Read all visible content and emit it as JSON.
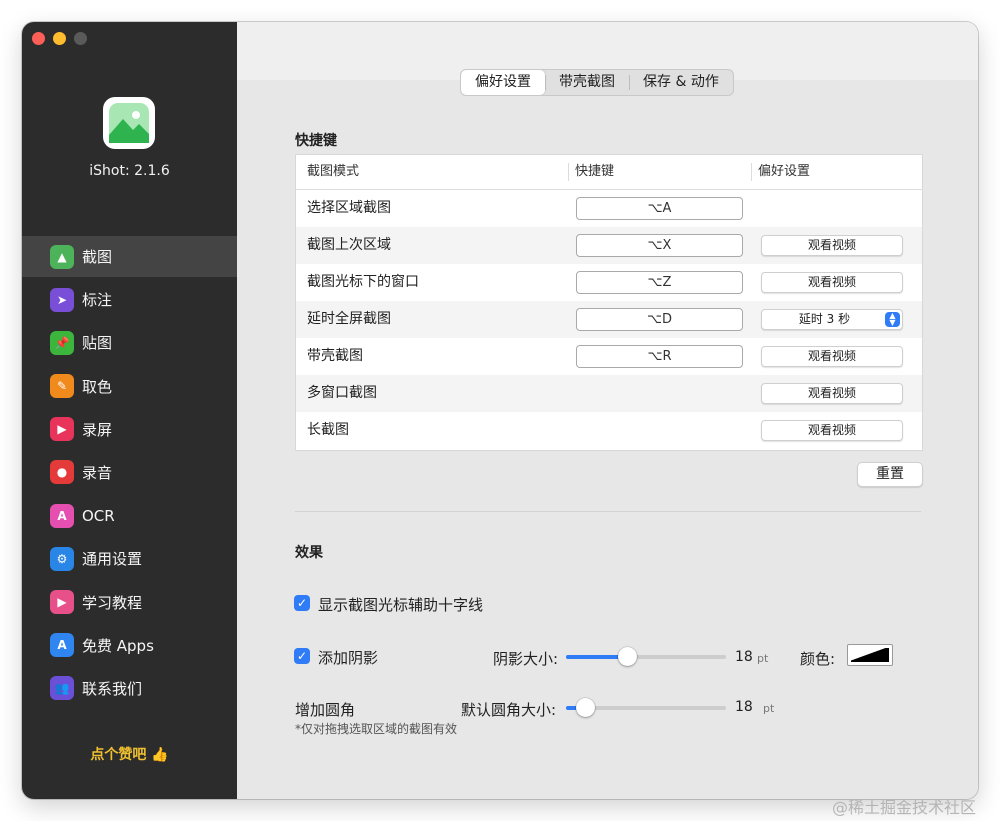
{
  "app": {
    "version_label": "iShot: 2.1.6"
  },
  "sidebar": {
    "items": [
      {
        "label": "截图",
        "icon": "screenshot-icon",
        "color": "#4cb35a",
        "glyph": "▲",
        "selected": true
      },
      {
        "label": "标注",
        "icon": "annotate-icon",
        "color": "#7a4fd8",
        "glyph": "➤",
        "selected": false
      },
      {
        "label": "贴图",
        "icon": "pin-icon",
        "color": "#3cb53d",
        "glyph": "📌",
        "selected": false
      },
      {
        "label": "取色",
        "icon": "eyedropper-icon",
        "color": "#f08a1c",
        "glyph": "✎",
        "selected": false
      },
      {
        "label": "录屏",
        "icon": "screen-record-icon",
        "color": "#e8335a",
        "glyph": "▶",
        "selected": false
      },
      {
        "label": "录音",
        "icon": "microphone-icon",
        "color": "#e53a3a",
        "glyph": "●",
        "selected": false
      },
      {
        "label": "OCR",
        "icon": "ocr-icon",
        "color": "#e44fb0",
        "glyph": "A",
        "selected": false
      },
      {
        "label": "通用设置",
        "icon": "gear-icon",
        "color": "#2a86e6",
        "glyph": "⚙",
        "selected": false
      },
      {
        "label": "学习教程",
        "icon": "tutorial-icon",
        "color": "#e8508a",
        "glyph": "▶",
        "selected": false
      },
      {
        "label": "免费 Apps",
        "icon": "app-store-icon",
        "color": "#2f86f0",
        "glyph": "A",
        "selected": false
      },
      {
        "label": "联系我们",
        "icon": "contacts-icon",
        "color": "#6b4fd6",
        "glyph": "👥",
        "selected": false
      }
    ],
    "like_text": "点个赞吧 👍"
  },
  "tabs": [
    {
      "label": "偏好设置",
      "active": true
    },
    {
      "label": "带壳截图",
      "active": false
    },
    {
      "label": "保存 & 动作",
      "active": false
    }
  ],
  "shortcuts": {
    "title": "快捷键",
    "headers": {
      "mode": "截图模式",
      "hotkey": "快捷键",
      "pref": "偏好设置"
    },
    "rows": [
      {
        "mode": "选择区域截图",
        "hotkey": "⌥A",
        "pref": ""
      },
      {
        "mode": "截图上次区域",
        "hotkey": "⌥X",
        "pref": "观看视频"
      },
      {
        "mode": "截图光标下的窗口",
        "hotkey": "⌥Z",
        "pref": "观看视频"
      },
      {
        "mode": "延时全屏截图",
        "hotkey": "⌥D",
        "pref": "延时 3 秒"
      },
      {
        "mode": "带壳截图",
        "hotkey": "⌥R",
        "pref": "观看视频"
      },
      {
        "mode": "多窗口截图",
        "hotkey": "",
        "pref": "观看视频"
      },
      {
        "mode": "长截图",
        "hotkey": "",
        "pref": "观看视频"
      }
    ],
    "reset_label": "重置"
  },
  "effects": {
    "title": "效果",
    "crosshair": {
      "label": "显示截图光标辅助十字线",
      "checked": true
    },
    "shadow": {
      "label": "添加阴影",
      "checked": true,
      "size_label": "阴影大小:",
      "value": "18",
      "unit": "pt",
      "level": 0.38,
      "color_label": "颜色:"
    },
    "corner": {
      "label": "增加圆角",
      "size_label": "默认圆角大小:",
      "value": "18",
      "unit": "pt",
      "level": 0.12,
      "note": "*仅对拖拽选取区域的截图有效"
    }
  },
  "watermark": "@稀土掘金技术社区"
}
